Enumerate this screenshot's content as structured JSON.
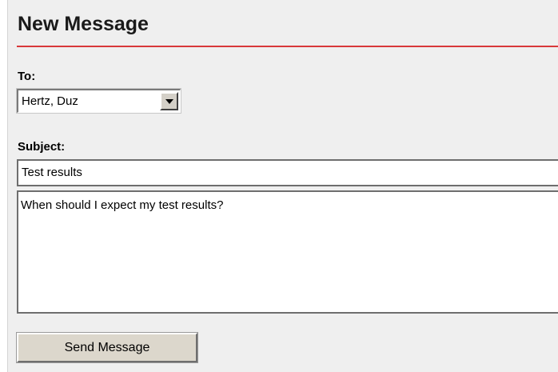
{
  "form": {
    "title": "New Message",
    "to_label": "To:",
    "to_value": "Hertz, Duz",
    "subject_label": "Subject:",
    "subject_value": "Test results",
    "body_value": "When should I expect my test results?",
    "send_label": "Send Message"
  },
  "colors": {
    "title_rule": "#d8383a",
    "panel_background": "#efefef"
  },
  "icons": {
    "dropdown": "chevron-down-icon"
  }
}
